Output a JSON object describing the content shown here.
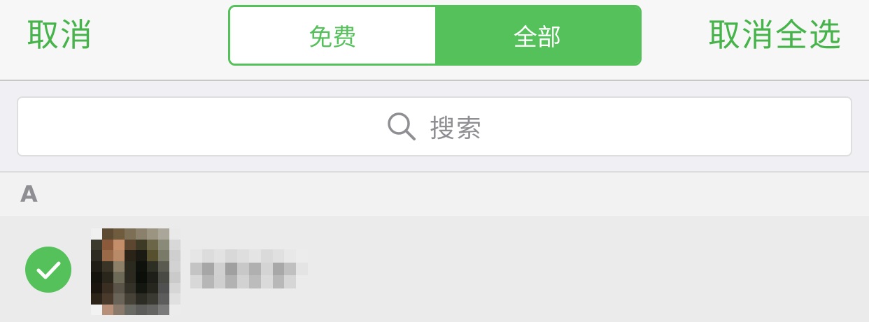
{
  "navbar": {
    "cancel_label": "取消",
    "deselect_all_label": "取消全选",
    "segments": [
      {
        "label": "免费",
        "active": false
      },
      {
        "label": "全部",
        "active": true
      }
    ]
  },
  "search": {
    "placeholder": "搜索",
    "icon": "search-icon"
  },
  "sections": [
    {
      "letter": "A",
      "contacts": [
        {
          "name": "",
          "selected": true,
          "avatar": "pixelated-avatar",
          "check_icon": "checkmark-icon"
        }
      ]
    }
  ],
  "colors": {
    "accent": "#55c15a",
    "accent_text": "#46b44a",
    "placeholder": "#8e8e93",
    "section_text": "#8e8e93"
  }
}
